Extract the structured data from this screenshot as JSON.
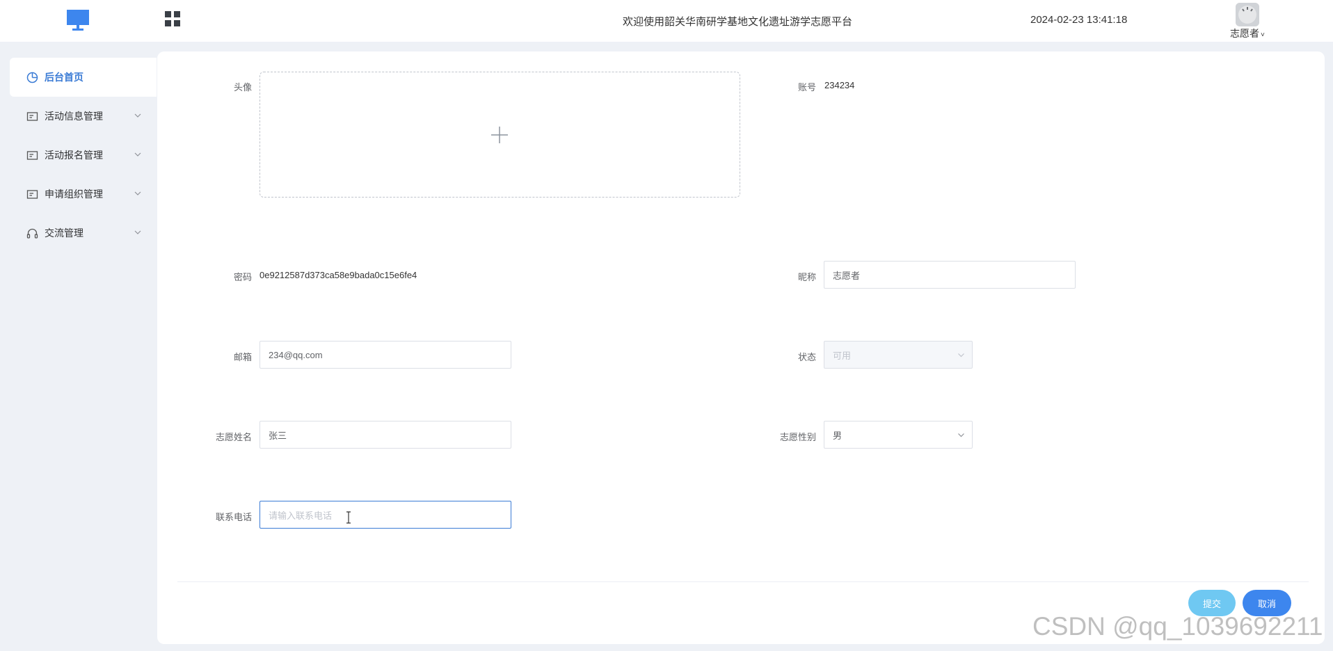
{
  "header": {
    "title": "欢迎使用韶关华南研学基地文化遗址游学志愿平台",
    "datetime": "2024-02-23 13:41:18",
    "user_name": "志愿者",
    "caret": "˅"
  },
  "sidebar": {
    "items": [
      {
        "label": "后台首页",
        "icon": "pie-chart-icon",
        "active": true
      },
      {
        "label": "活动信息管理",
        "icon": "document-icon",
        "expandable": true
      },
      {
        "label": "活动报名管理",
        "icon": "document-icon",
        "expandable": true
      },
      {
        "label": "申请组织管理",
        "icon": "document-icon",
        "expandable": true
      },
      {
        "label": "交流管理",
        "icon": "headset-icon",
        "expandable": true
      }
    ]
  },
  "form": {
    "avatar_label": "头像",
    "account_label": "账号",
    "account_value": "234234",
    "password_label": "密码",
    "password_value": "0e9212587d373ca58e9bada0c15e6fe4",
    "nickname_label": "昵称",
    "nickname_value": "志愿者",
    "email_label": "邮箱",
    "email_value": "234@qq.com",
    "status_label": "状态",
    "status_value": "可用",
    "name_label": "志愿姓名",
    "name_value": "张三",
    "gender_label": "志愿性别",
    "gender_value": "男",
    "phone_label": "联系电话",
    "phone_placeholder": "请输入联系电话"
  },
  "actions": {
    "submit_label": "提交",
    "cancel_label": "取消"
  },
  "watermark": "CSDN @qq_1039692211",
  "colors": {
    "accent": "#3a7bd5",
    "submit": "#6fc8f2",
    "cancel": "#3d86ee",
    "background": "#eef1f6"
  }
}
